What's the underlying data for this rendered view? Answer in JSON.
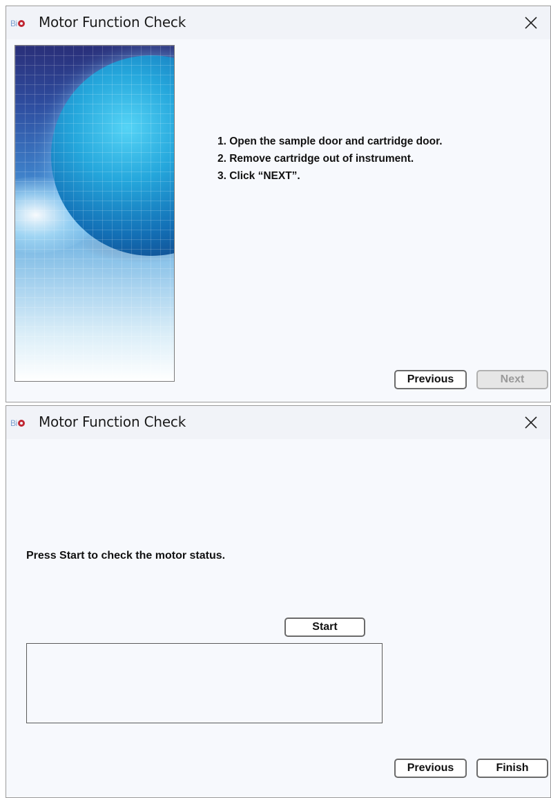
{
  "window1": {
    "title": "Motor Function Check",
    "logo_text": "Bi",
    "instructions": [
      "1. Open the sample door and cartridge door.",
      "2. Remove cartridge out of instrument.",
      "3. Click “NEXT”."
    ],
    "previous_label": "Previous",
    "next_label": "Next"
  },
  "window2": {
    "title": "Motor Function Check",
    "logo_text": "Bi",
    "prompt": "Press Start to check the motor status.",
    "start_label": "Start",
    "status_text": "",
    "previous_label": "Previous",
    "finish_label": "Finish"
  },
  "icons": {
    "app_logo": "app-logo-icon",
    "close": "close-icon"
  },
  "colors": {
    "window_bg": "#f7f9fd",
    "titlebar_bg": "#f1f3f8",
    "logo_red": "#c02632",
    "logo_blue": "#7aa0cf",
    "disabled_button_bg": "#e6e6e6",
    "disabled_button_text": "#9a9a9a"
  }
}
